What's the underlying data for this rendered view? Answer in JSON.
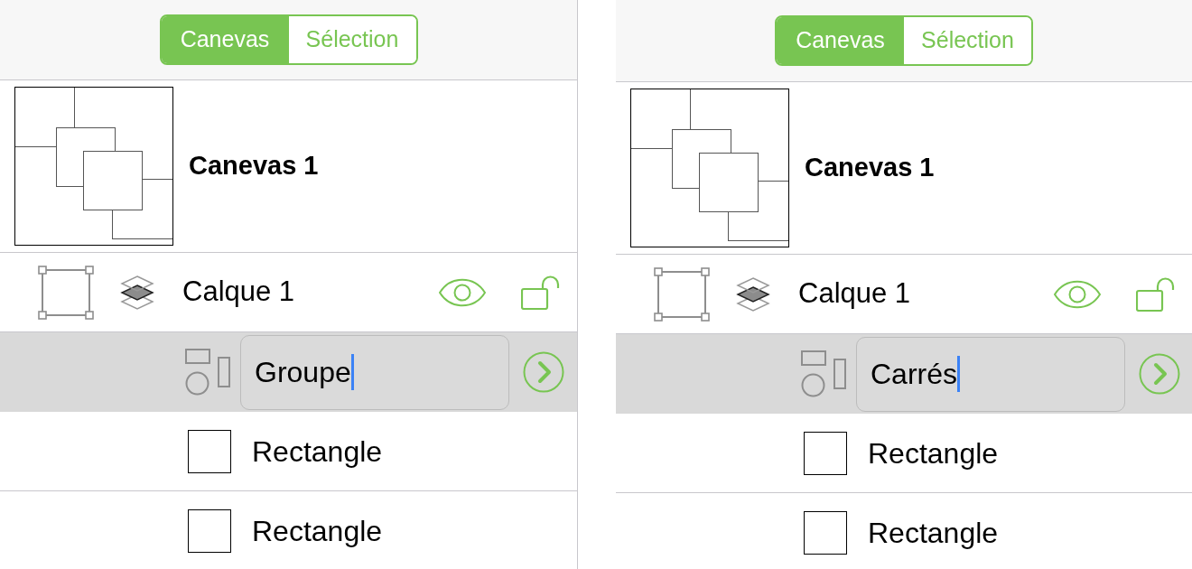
{
  "panels": [
    {
      "segments": [
        {
          "label": "Canevas",
          "selected": true
        },
        {
          "label": "Sélection",
          "selected": false
        }
      ],
      "canvas": {
        "name": "Canevas 1"
      },
      "layer": {
        "name": "Calque 1",
        "visible": true,
        "locked": false,
        "children": [
          {
            "kind": "group",
            "name": "Groupe",
            "selected": true,
            "editing": true
          },
          {
            "kind": "rectangle",
            "name": "Rectangle",
            "selected": false,
            "editing": false
          },
          {
            "kind": "rectangle",
            "name": "Rectangle",
            "selected": false,
            "editing": false
          }
        ]
      }
    },
    {
      "segments": [
        {
          "label": "Canevas",
          "selected": true
        },
        {
          "label": "Sélection",
          "selected": false
        }
      ],
      "canvas": {
        "name": "Canevas 1"
      },
      "layer": {
        "name": "Calque 1",
        "visible": true,
        "locked": false,
        "children": [
          {
            "kind": "group",
            "name": "Carrés",
            "selected": true,
            "editing": true
          },
          {
            "kind": "rectangle",
            "name": "Rectangle",
            "selected": false,
            "editing": false
          },
          {
            "kind": "rectangle",
            "name": "Rectangle",
            "selected": false,
            "editing": false
          }
        ]
      }
    }
  ]
}
